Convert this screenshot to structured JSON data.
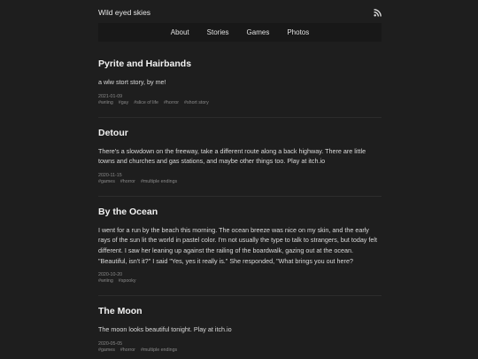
{
  "header": {
    "site_title": "Wild eyed skies",
    "rss_icon": "rss-icon"
  },
  "nav": {
    "items": [
      {
        "label": "About"
      },
      {
        "label": "Stories"
      },
      {
        "label": "Games"
      },
      {
        "label": "Photos"
      }
    ]
  },
  "posts": [
    {
      "title": "Pyrite and Hairbands",
      "body": "a wlw stort story, by me!",
      "date": "2021-01-09",
      "tags": [
        "#wriing",
        "#gay",
        "#slice of life",
        "#horror",
        "#short story"
      ]
    },
    {
      "title": "Detour",
      "body": "There's a slowdown on the freeway, take a different route along a back highway. There are little towns and churches and gas stations, and maybe other things too. Play at itch.io",
      "date": "2020-11-15",
      "tags": [
        "#games",
        "#horror",
        "#multiple endings"
      ]
    },
    {
      "title": "By the Ocean",
      "body": "I went for a run by the beach this morning. The ocean breeze was nice on my skin, and the early rays of the sun lit the world in pastel color. I'm not usually the type to talk to strangers, but today felt different. I saw her leaning up against the railing of the boardwalk, gazing out at the ocean. \"Beautiful, isn't it?\" I said \"Yes, yes it really is.\" She responded, \"What brings you out here?",
      "date": "2020-10-20",
      "tags": [
        "#wriing",
        "#spooky"
      ]
    },
    {
      "title": "The Moon",
      "body": "The moon looks beautiful tonight. Play at itch.io",
      "date": "2020-05-05",
      "tags": [
        "#games",
        "#horror",
        "#multiple endings"
      ]
    }
  ]
}
